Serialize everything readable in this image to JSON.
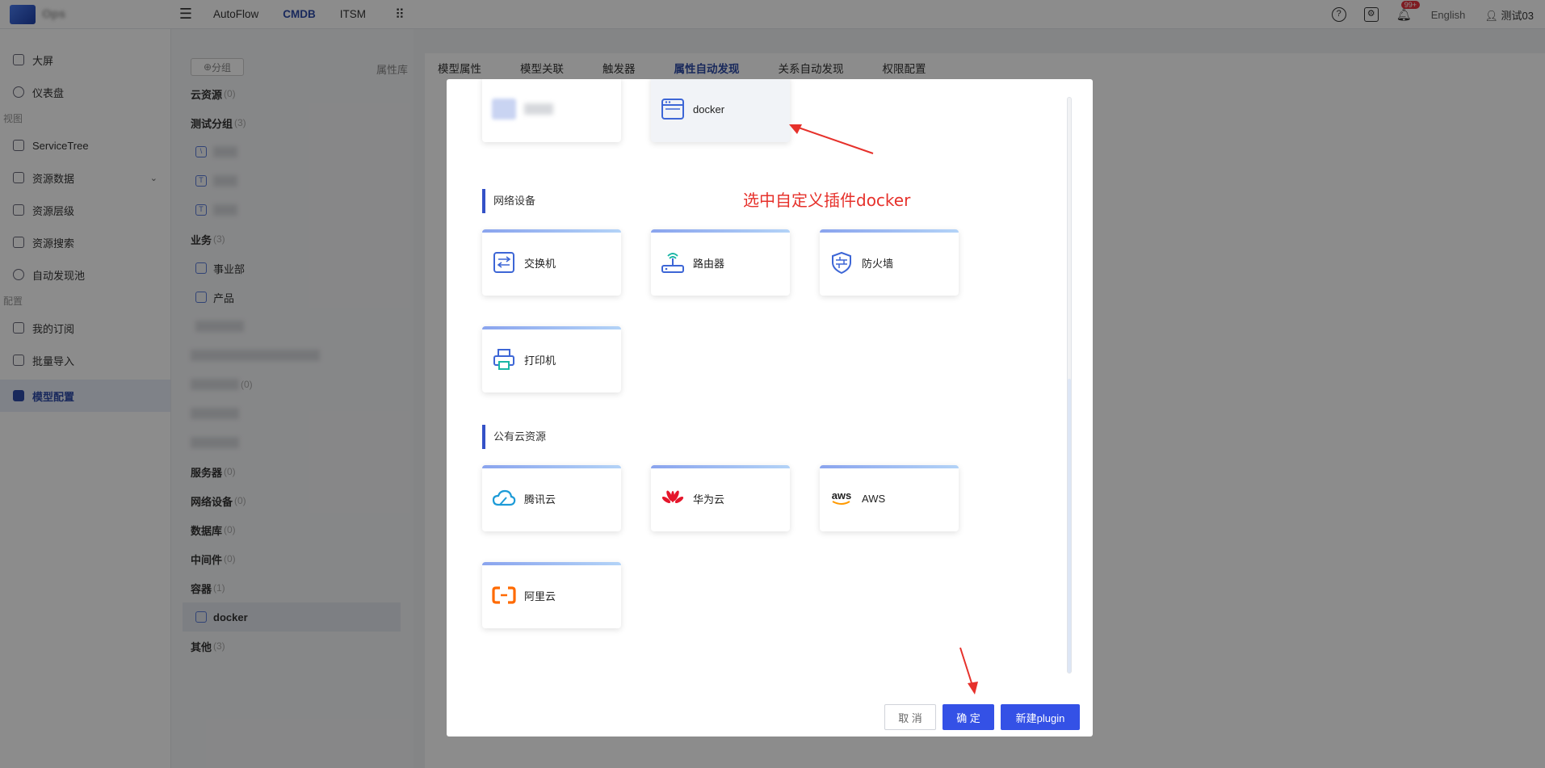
{
  "topbar": {
    "nav": [
      "AutoFlow",
      "CMDB",
      "ITSM"
    ],
    "active_nav": "CMDB",
    "badge": "99+",
    "language": "English",
    "user": "测试03"
  },
  "sidebar": {
    "items": [
      {
        "label": "大屏"
      },
      {
        "label": "仪表盘"
      }
    ],
    "group_view": "视图",
    "view_items": [
      {
        "label": "ServiceTree"
      },
      {
        "label": "资源数据"
      },
      {
        "label": "资源层级"
      },
      {
        "label": "资源搜索"
      },
      {
        "label": "自动发现池"
      }
    ],
    "group_config": "配置",
    "config_items": [
      {
        "label": "我的订阅"
      },
      {
        "label": "批量导入"
      },
      {
        "label": "模型配置"
      }
    ]
  },
  "tree": {
    "add_label": "分组",
    "rows": [
      {
        "label": "云资源",
        "count": "(0)"
      },
      {
        "label": "测试分组",
        "count": "(3)"
      },
      {
        "label": "业务",
        "count": "(3)"
      },
      {
        "label": "事业部"
      },
      {
        "label": "产品"
      },
      {
        "label": "服务器",
        "count": "(0)"
      },
      {
        "label": "网络设备",
        "count": "(0)"
      },
      {
        "label": "数据库",
        "count": "(0)"
      },
      {
        "label": "中间件",
        "count": "(0)"
      },
      {
        "label": "容器",
        "count": "(1)"
      },
      {
        "label": "docker"
      },
      {
        "label": "其他",
        "count": "(3)"
      }
    ],
    "blur_counts": [
      "(0)"
    ]
  },
  "tabs": {
    "left_label": "属性库",
    "items": [
      "模型属性",
      "模型关联",
      "触发器",
      "属性自动发现",
      "关系自动发现",
      "权限配置"
    ],
    "active": "属性自动发现"
  },
  "modal": {
    "top_cards": [
      {
        "label": "",
        "icon": "blurred-icon"
      },
      {
        "label": "docker",
        "icon": "window-icon"
      }
    ],
    "section_network": "网络设备",
    "network_cards": [
      {
        "label": "交换机",
        "icon": "switch-icon"
      },
      {
        "label": "路由器",
        "icon": "router-icon"
      },
      {
        "label": "防火墙",
        "icon": "firewall-icon"
      },
      {
        "label": "打印机",
        "icon": "printer-icon"
      }
    ],
    "section_cloud": "公有云资源",
    "cloud_cards": [
      {
        "label": "腾讯云",
        "icon": "tencent-cloud-icon"
      },
      {
        "label": "华为云",
        "icon": "huawei-icon"
      },
      {
        "label": "AWS",
        "icon": "aws-icon",
        "logo_text": "aws"
      },
      {
        "label": "阿里云",
        "icon": "aliyun-icon"
      }
    ],
    "annotation": "选中自定义插件docker",
    "buttons": {
      "cancel": "取 消",
      "ok": "确 定",
      "new": "新建plugin"
    }
  },
  "colors": {
    "primary": "#3451e6",
    "annotation": "#e6312b",
    "huawei": "#e5162b",
    "aliyun": "#ff6a00",
    "tencent": "#1d9bd7"
  }
}
